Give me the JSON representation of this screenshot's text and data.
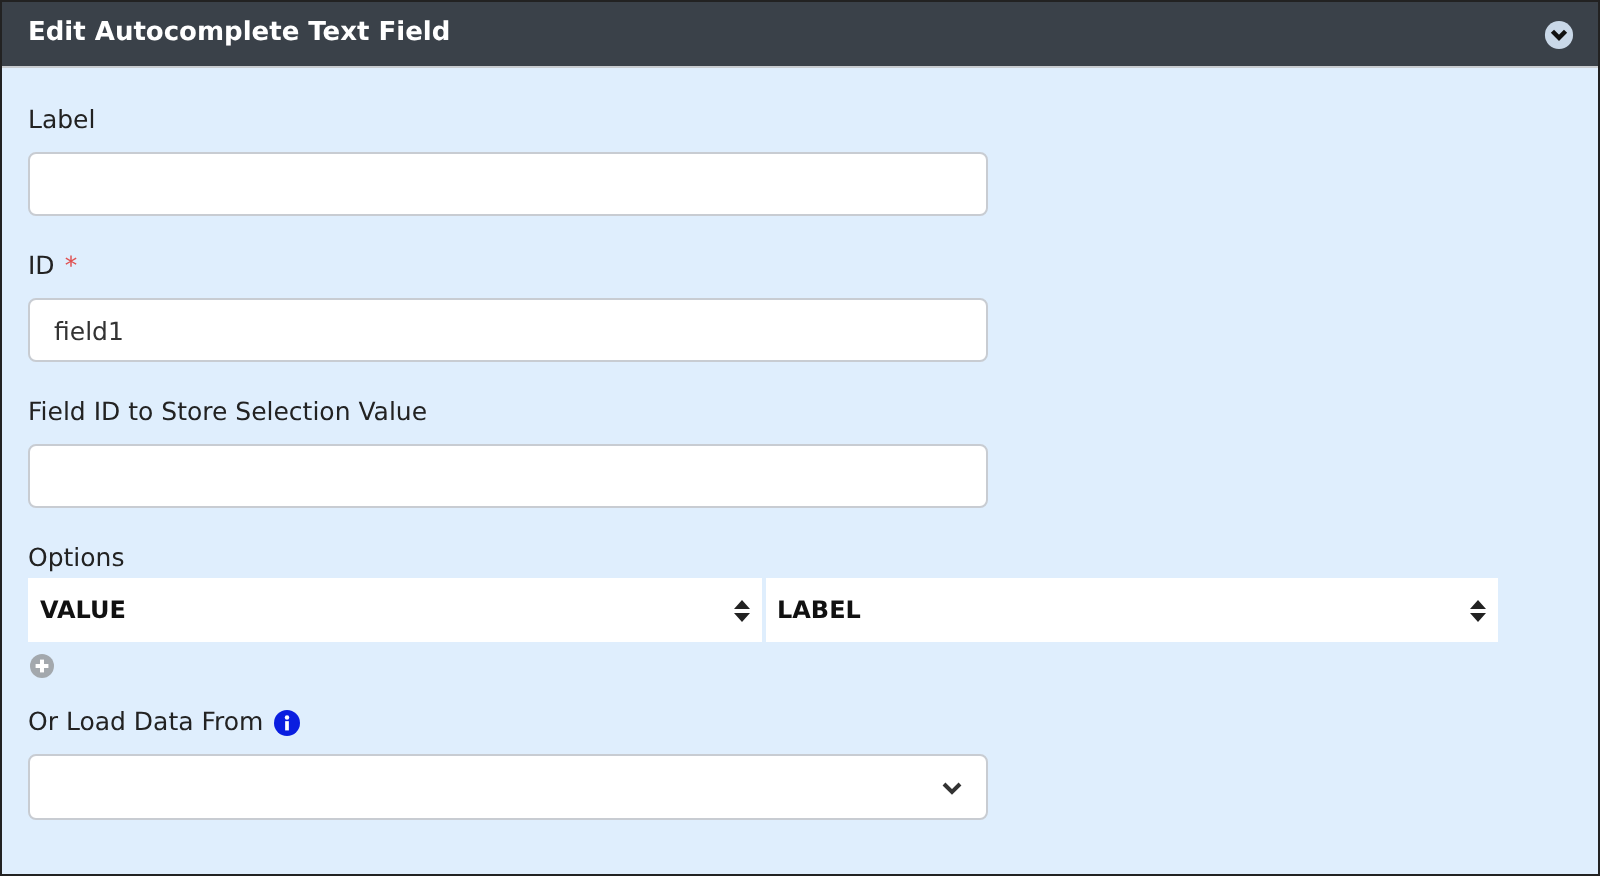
{
  "panel": {
    "title": "Edit Autocomplete Text Field",
    "collapsed": false
  },
  "fields": [
    {
      "kind": "text",
      "label": "Label"
    },
    {
      "kind": "text",
      "label": "ID",
      "required_mark": "*",
      "value": "field1"
    },
    {
      "kind": "text",
      "label": "Field ID to Store Selection Value"
    },
    {
      "kind": "table",
      "label": "Options",
      "columns": [
        "VALUE",
        "LABEL"
      ]
    },
    {
      "kind": "select",
      "label": "Or Load Data From",
      "info": true
    }
  ]
}
